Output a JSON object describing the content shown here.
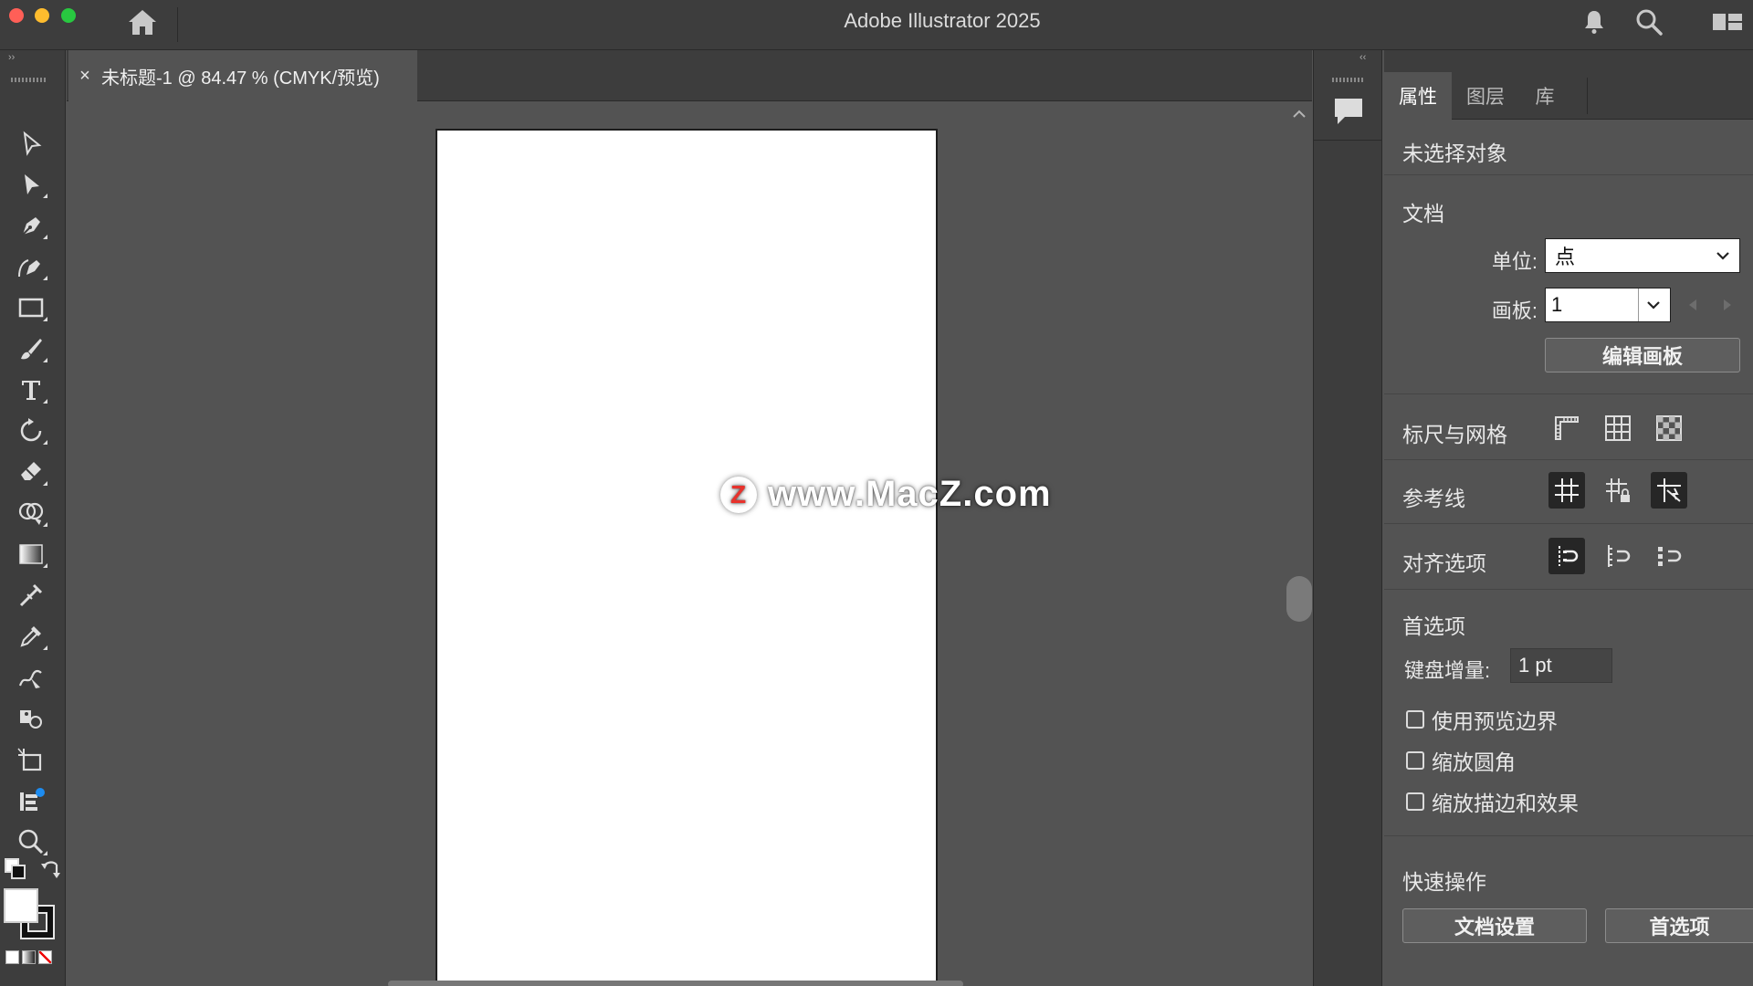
{
  "titlebar": {
    "app_title": "Adobe Illustrator 2025"
  },
  "document": {
    "tab_title": "未标题-1 @ 84.47 % (CMYK/预览)",
    "close_glyph": "×"
  },
  "canvas": {
    "watermark_text": "www.MacZ.com",
    "watermark_logo": "Z"
  },
  "panel": {
    "tabs": [
      {
        "label": "属性",
        "active": true
      },
      {
        "label": "图层",
        "active": false
      },
      {
        "label": "库",
        "active": false
      }
    ],
    "no_selection": "未选择对象",
    "document_section": {
      "title": "文档",
      "units_label": "单位:",
      "units_value": "点",
      "artboard_label": "画板:",
      "artboard_value": "1",
      "edit_artboard_button": "编辑画板"
    },
    "rulers_grids": {
      "title": "标尺与网格"
    },
    "guides": {
      "title": "参考线"
    },
    "snap_options": {
      "title": "对齐选项"
    },
    "preferences": {
      "title": "首选项",
      "keyboard_increment_label": "键盘增量:",
      "keyboard_increment_value": "1 pt",
      "checkboxes": [
        {
          "label": "使用预览边界",
          "checked": false
        },
        {
          "label": "缩放圆角",
          "checked": false
        },
        {
          "label": "缩放描边和效果",
          "checked": false
        }
      ]
    },
    "quick_actions": {
      "title": "快速操作",
      "document_setup_button": "文档设置",
      "preferences_button": "首选项"
    }
  },
  "colors": {
    "ui_dark": "#3d3d3d",
    "ui_mid": "#535353",
    "artboard": "#ffffff",
    "watermark_red": "#e8322c"
  }
}
